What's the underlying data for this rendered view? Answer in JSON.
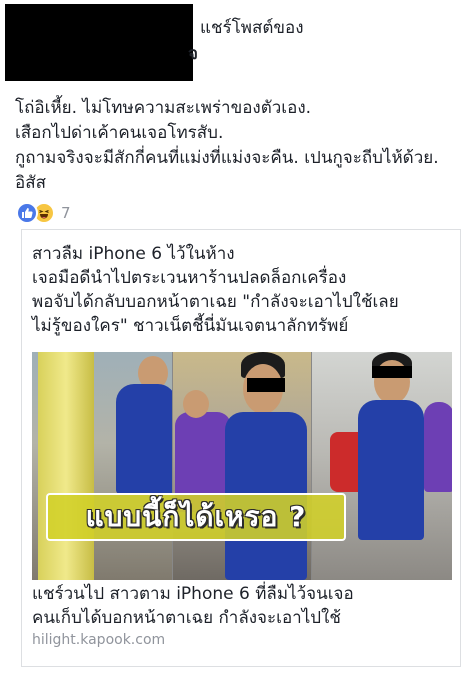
{
  "header": {
    "line1": "แชร์โพสต์ของ",
    "line2": "จ"
  },
  "post": {
    "lines": [
      "โถ่อิเหี้ย. ไม่โทษความสะเพร่าของตัวเอง.",
      "เสือกไปด่าเค้าคนเจอโทรสับ.",
      "กูถามจริงจะมีสักกี่คนที่แม่งที่แม่งจะคืน. เปนกูจะถีบไห้ด้วย.",
      "อิสัส"
    ]
  },
  "reactions": {
    "icons": [
      "like-icon",
      "haha-icon"
    ],
    "count": "7",
    "like_color": "#4a78e8",
    "haha_color": "#f7c642"
  },
  "link_card": {
    "title_lines": [
      "สาวลืม iPhone 6 ไว้ในห้าง",
      "เจอมือดีนำไปตระเวนหาร้านปลดล็อกเครื่อง",
      "พอจับได้กลับบอกหน้าตาเฉย \"กำลังจะเอาไปใช้เลย",
      "ไม่รู้ของใคร\" ชาวเน็ตชี้นี่มันเจตนาลักทรัพย์"
    ],
    "image_caption": "แบบนี้ก็ได้เหรอ ?",
    "caption_lines": [
      "แชร์วนไป สาวตาม iPhone 6 ที่ลืมไว้จนเจอ",
      "คนเก็บได้บอกหน้าตาเฉย กำลังจะเอาไปใช้"
    ],
    "domain": "hilight.kapook.com"
  }
}
